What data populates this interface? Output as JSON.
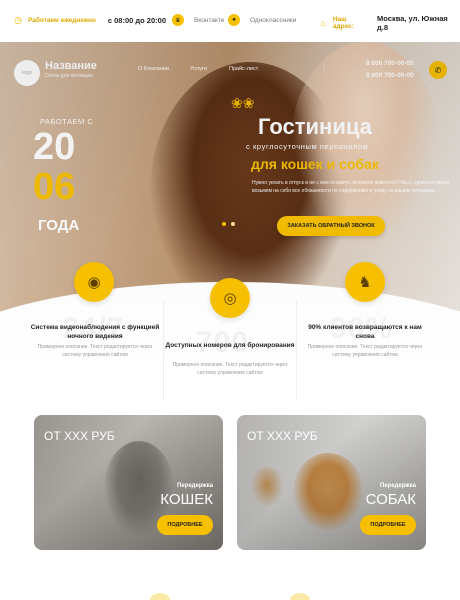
{
  "topbar": {
    "hours_label": "Работаем ежедневно",
    "hours_value": "с 08:00 до 20:00",
    "vk_label": "Вконтакте",
    "ok_label": "Одноклассники",
    "address_label": "Наш адрес:",
    "address_value": "Москва, ул. Южная д.8"
  },
  "header": {
    "logo_placeholder": "logo",
    "brand_name": "Название",
    "brand_sub": "Отель для питомцев",
    "nav": [
      "О Компании",
      "Услуги",
      "Прайс-лист"
    ],
    "more": "⋮",
    "phones": [
      "8 800 700-00-00",
      "8 800 700-00-00"
    ]
  },
  "hero": {
    "since": "РАБОТАЕМ С",
    "year_top": "20",
    "year_bottom": "06",
    "years_word": "ГОДА",
    "title": "Гостиница",
    "subtitle": "с круглосуточным персоналом",
    "title_yellow": "для кошек и собак",
    "description": "Нужно уехать в отпуск и не с кем оставить любимое животное? Мы с удовольствием возьмем на себя все обязанности по содержанию и уходу за вашим питомцем.",
    "cta": "ЗАКАЗАТЬ ОБРАТНЫЙ ЗВОНОК"
  },
  "features": [
    {
      "ghost": "24/7",
      "title": "Система видеонаблюдения с функцией ночного видения",
      "desc": "Примерное описание. Текст редактируется через систему управления сайтом"
    },
    {
      "ghost": "700",
      "title": "Доступных номеров для бронирования",
      "desc": "Примерное описание. Текст редактируется через систему управления сайтом"
    },
    {
      "ghost": "90%",
      "title": "90% клиентов возвращаются к нам снова",
      "desc": "Примерное описание. Текст редактируется через систему управления сайтом"
    }
  ],
  "cards": [
    {
      "price": "ОТ XXX РУБ",
      "sub": "Передержка",
      "big": "КОШЕК",
      "button": "ПОДРОБНЕЕ"
    },
    {
      "price": "ОТ XXX РУБ",
      "sub": "Передержка",
      "big": "СОБАК",
      "button": "ПОДРОБНЕЕ"
    }
  ],
  "colors": {
    "accent": "#f6c000"
  }
}
